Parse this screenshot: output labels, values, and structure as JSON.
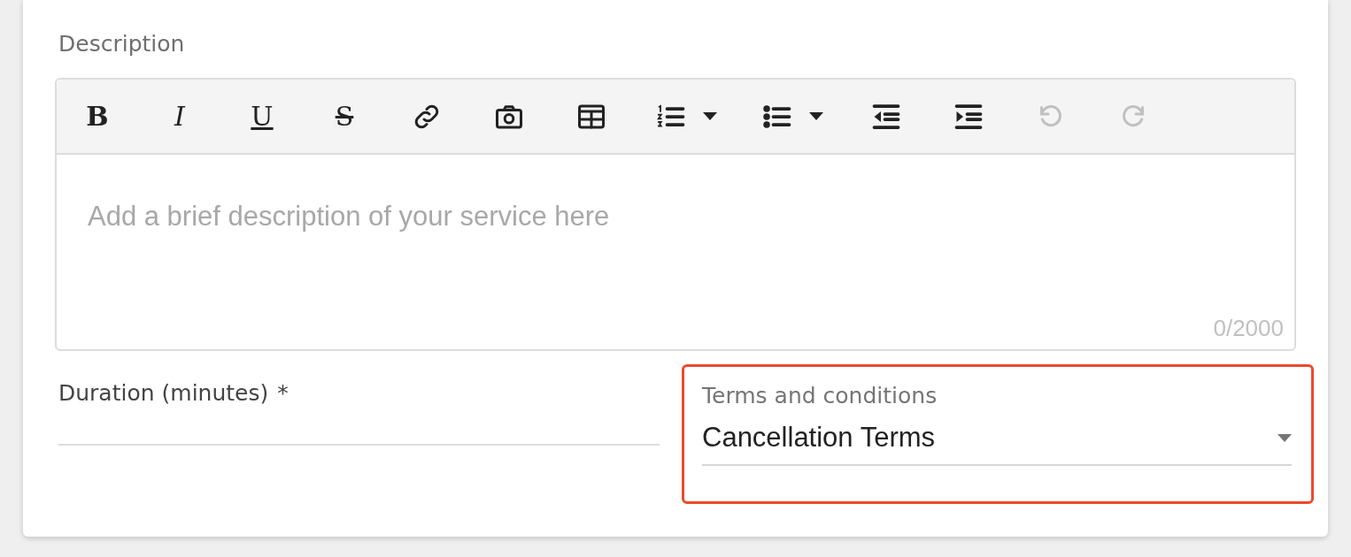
{
  "description": {
    "label": "Description",
    "toolbar": [
      {
        "kind": "bold",
        "label": "B",
        "disabled": false
      },
      {
        "kind": "italic",
        "label": "I",
        "disabled": false
      },
      {
        "kind": "underline",
        "label": "U",
        "disabled": false
      },
      {
        "kind": "strike",
        "label": "S",
        "disabled": false
      },
      {
        "kind": "link",
        "disabled": false
      },
      {
        "kind": "image",
        "disabled": false
      },
      {
        "kind": "table",
        "disabled": false
      },
      {
        "kind": "numbered-list",
        "disabled": false
      },
      {
        "kind": "bullet-list",
        "disabled": false
      },
      {
        "kind": "outdent",
        "disabled": false
      },
      {
        "kind": "indent",
        "disabled": false
      },
      {
        "kind": "undo",
        "disabled": true
      },
      {
        "kind": "redo",
        "disabled": true
      }
    ],
    "placeholder": "Add a brief description of your service here",
    "counter": "0/2000"
  },
  "duration": {
    "label": "Duration (minutes)",
    "required_mark": "*"
  },
  "terms": {
    "label": "Terms and conditions",
    "value": "Cancellation Terms",
    "highlighted": true
  }
}
